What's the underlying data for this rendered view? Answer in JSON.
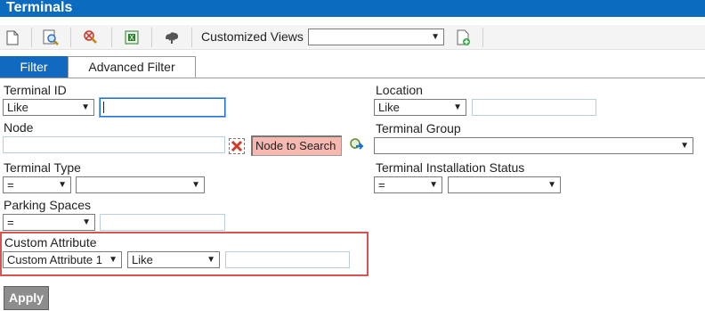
{
  "window": {
    "title": "Terminals"
  },
  "toolbar": {
    "icons": [
      "new-icon",
      "search-icon",
      "remove-icon",
      "export-excel-icon",
      "upload-icon",
      "add-view-icon"
    ],
    "customized_views_label": "Customized Views",
    "customized_views_value": ""
  },
  "tabs": [
    {
      "label": "Filter",
      "active": true
    },
    {
      "label": "Advanced Filter",
      "active": false
    }
  ],
  "filters": {
    "terminal_id": {
      "label": "Terminal ID",
      "operator": "Like",
      "value": ""
    },
    "location": {
      "label": "Location",
      "operator": "Like",
      "value": ""
    },
    "node": {
      "label": "Node",
      "value": "",
      "search_button": "Node to Search"
    },
    "terminal_group": {
      "label": "Terminal Group",
      "value": ""
    },
    "terminal_type": {
      "label": "Terminal Type",
      "operator": "=",
      "value": ""
    },
    "installation_status": {
      "label": "Terminal Installation Status",
      "operator": "=",
      "value": ""
    },
    "parking_spaces": {
      "label": "Parking Spaces",
      "operator": "=",
      "value": ""
    },
    "custom_attribute": {
      "label": "Custom Attribute",
      "attribute": "Custom Attribute 1",
      "operator": "Like",
      "value": ""
    }
  },
  "actions": {
    "apply": "Apply"
  },
  "colors": {
    "header": "#0b6bbf",
    "active_tab": "#1169c0",
    "highlight": "#d9534f",
    "node_search_bg": "#f6b9b1"
  }
}
